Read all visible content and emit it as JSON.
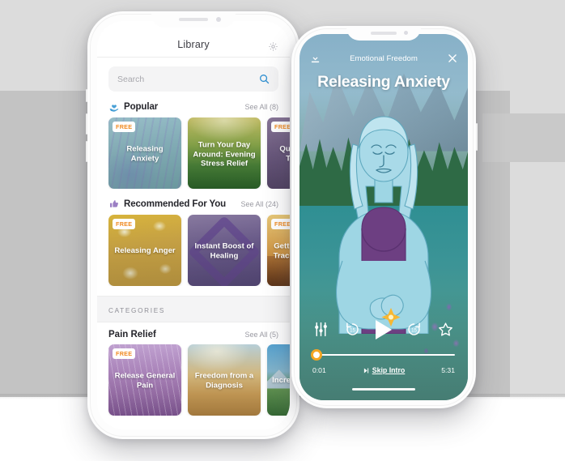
{
  "background": {
    "plate_light": "#dcdcdc",
    "plate_mid": "#c3c3c3",
    "plate_band": "#c9c9c9",
    "page": "#ffffff"
  },
  "library_phone": {
    "header": {
      "title": "Library",
      "settings_icon": "gear-icon"
    },
    "search": {
      "placeholder": "Search",
      "value": "",
      "icon": "search-icon"
    },
    "sections": [
      {
        "id": "popular",
        "icon": "hand-heart-icon",
        "title": "Popular",
        "see_all": "See All (8)",
        "cards": [
          {
            "title": "Releasing Anxiety",
            "badge": "FREE",
            "art": "art-lav"
          },
          {
            "title": "Turn Your Day Around: Evening Stress Relief",
            "badge": "",
            "art": "art-field"
          },
          {
            "title": "Quiet Racing Thoughts",
            "badge": "FREE",
            "art": "art-purple"
          }
        ]
      },
      {
        "id": "recommended",
        "icon": "thumbs-up-icon",
        "title": "Recommended For You",
        "see_all": "See All (24)",
        "cards": [
          {
            "title": "Releasing Anger",
            "badge": "FREE",
            "art": "art-daisy"
          },
          {
            "title": "Instant Boost of Healing",
            "badge": "",
            "art": "art-heal"
          },
          {
            "title": "Getting Back on Track After Loss",
            "badge": "FREE",
            "art": "art-sunset"
          }
        ]
      }
    ],
    "categories_label": "CATEGORIES",
    "category_section": {
      "title": "Pain Relief",
      "see_all": "See All (5)",
      "cards": [
        {
          "title": "Release General Pain",
          "badge": "FREE",
          "art": "art-dune"
        },
        {
          "title": "Freedom from a Diagnosis",
          "badge": "",
          "art": "art-sky"
        },
        {
          "title": "Increase Mobility",
          "badge": "",
          "art": "art-mtn"
        }
      ]
    }
  },
  "player_phone": {
    "download_icon": "download-icon",
    "collection": "Emotional Freedom",
    "close_icon": "close-icon",
    "track_title": "Releasing Anxiety",
    "controls": {
      "equalizer_icon": "equalizer-icon",
      "rewind_label": "15",
      "rewind_icon": "rewind-15-icon",
      "play_icon": "play-icon",
      "forward_label": "15",
      "forward_icon": "forward-15-icon",
      "favorite_icon": "star-icon"
    },
    "progress": {
      "elapsed": "0:01",
      "duration": "5:31",
      "percent": 1,
      "knob_color": "#f5a623"
    },
    "skip_intro": "Skip Intro",
    "skip_icon": "skip-next-icon"
  }
}
